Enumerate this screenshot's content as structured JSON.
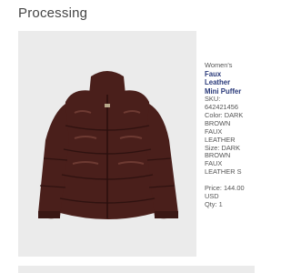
{
  "header": {
    "status": "Processing"
  },
  "product": {
    "image_icon": "puffer-jacket-photo",
    "category": "Women's",
    "name_line1": "Faux",
    "name_line2": "Leather",
    "name_line3": "Mini Puffer",
    "sku_label": "SKU:",
    "sku_value": "642421456",
    "color_line1": "Color: DARK",
    "color_line2": "BROWN",
    "color_line3": "FAUX",
    "color_line4": "LEATHER",
    "size_line1": "Size: DARK",
    "size_line2": "BROWN",
    "size_line3": "FAUX",
    "size_line4": "LEATHER S",
    "price_line1": "Price: 144.00",
    "price_line2": "USD",
    "qty": "Qty: 1"
  },
  "colors": {
    "jacket": "#4a1f1b",
    "image_bg": "#ebebeb",
    "name": "#2a3a7a"
  }
}
